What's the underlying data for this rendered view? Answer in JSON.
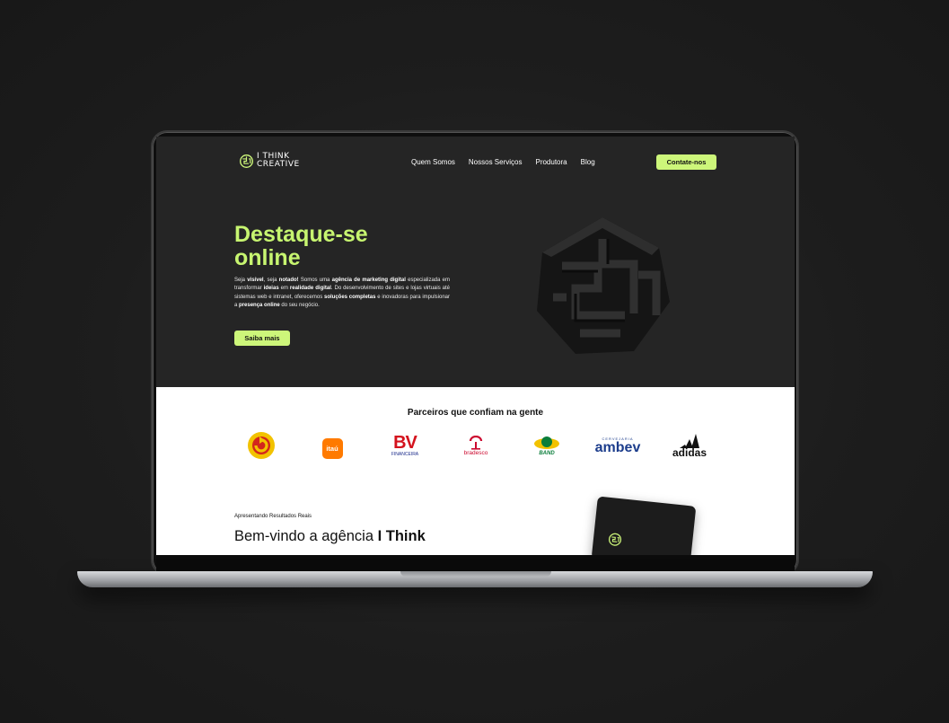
{
  "logo": {
    "line1": "I THINK",
    "line2": "CREATIVE"
  },
  "nav": {
    "links": [
      "Quem Somos",
      "Nossos Serviços",
      "Produtora",
      "Blog"
    ],
    "cta": "Contate-nos"
  },
  "hero": {
    "title": "Destaque-se online",
    "desc": [
      {
        "t": "Seja ",
        "b": false
      },
      {
        "t": "visível",
        "b": true
      },
      {
        "t": ", seja ",
        "b": false
      },
      {
        "t": "notado!",
        "b": true
      },
      {
        "t": " Somos uma ",
        "b": false
      },
      {
        "t": "agência de marketing digital",
        "b": true
      },
      {
        "t": " especializada em transformar ",
        "b": false
      },
      {
        "t": "ideias",
        "b": true
      },
      {
        "t": " em ",
        "b": false
      },
      {
        "t": "realidade digital",
        "b": true
      },
      {
        "t": ". Do desenvolvimento de sites e lojas virtuais até sistemas web e intranet, oferecemos ",
        "b": false
      },
      {
        "t": "soluções completas",
        "b": true
      },
      {
        "t": " e inovadoras para impulsionar a ",
        "b": false
      },
      {
        "t": "presença online",
        "b": true
      },
      {
        "t": " do seu negócio.",
        "b": false
      }
    ],
    "button": "Saiba mais"
  },
  "partners": {
    "title": "Parceiros que confiam na gente",
    "logos": [
      "Itaú",
      "BV Financeira",
      "Bradesco",
      "Band",
      "Ambev",
      "Adidas"
    ],
    "itau_text": "itaú",
    "bv_text": "BV",
    "bv_sub": "FINANCEIRA",
    "bradesco_text": "bradesco",
    "band_text": "BAND",
    "ambev_top": "CERVEJARIA",
    "ambev_text": "ambev",
    "adidas_text": "adidas"
  },
  "results": {
    "kicker": "Apresentando Resultados Reais",
    "title_plain": "Bem-vindo a agência ",
    "title_bold": "I Think"
  },
  "colors": {
    "accent": "#cdf67a",
    "hero_bg": "#252525",
    "page_bg": "#1d1d1d"
  }
}
